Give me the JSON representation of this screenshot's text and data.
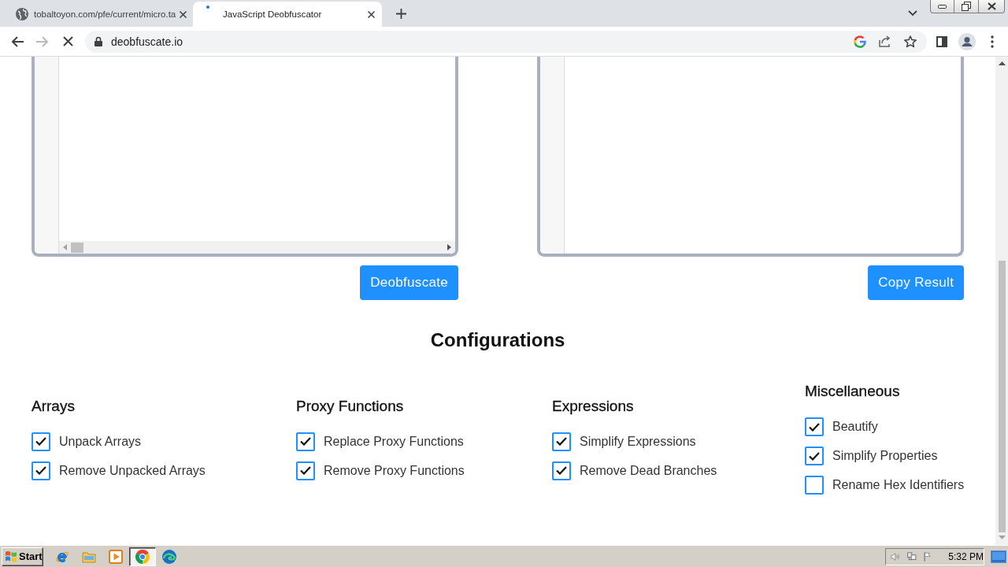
{
  "browser": {
    "tabs": [
      {
        "kind": "globe",
        "title": "tobaltoyon.com/pfe/current/micro.ta",
        "selected": false
      },
      {
        "kind": "loading",
        "title": "JavaScript Deobfuscator",
        "selected": true
      }
    ],
    "address": "deobfuscate.io"
  },
  "editors": [
    {
      "kind": "input",
      "button": "Deobfuscate"
    },
    {
      "kind": "output",
      "button": "Copy Result"
    }
  ],
  "configurations": {
    "title": "Configurations",
    "groups": [
      {
        "title": "Arrays",
        "options": [
          {
            "label": "Unpack Arrays",
            "checked": true
          },
          {
            "label": "Remove Unpacked Arrays",
            "checked": true
          }
        ]
      },
      {
        "title": "Proxy Functions",
        "options": [
          {
            "label": "Replace Proxy Functions",
            "checked": true
          },
          {
            "label": "Remove Proxy Functions",
            "checked": true
          }
        ]
      },
      {
        "title": "Expressions",
        "options": [
          {
            "label": "Simplify Expressions",
            "checked": true
          },
          {
            "label": "Remove Dead Branches",
            "checked": true
          }
        ]
      },
      {
        "title": "Miscellaneous",
        "options": [
          {
            "label": "Beautify",
            "checked": true
          },
          {
            "label": "Simplify Properties",
            "checked": true
          },
          {
            "label": "Rename Hex Identifiers",
            "checked": false
          }
        ]
      }
    ]
  },
  "taskbar": {
    "start": "Start",
    "apps": [
      {
        "kind": "e-letter",
        "selected": false
      },
      {
        "kind": "folder",
        "selected": false
      },
      {
        "kind": "play",
        "selected": false
      },
      {
        "kind": "ring",
        "selected": true
      },
      {
        "kind": "swirl",
        "selected": false
      }
    ],
    "clock": "5:32 PM"
  }
}
